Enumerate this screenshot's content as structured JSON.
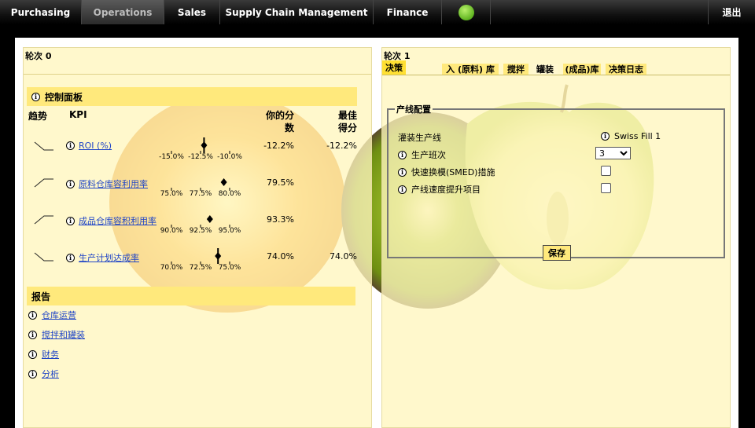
{
  "nav": {
    "tabs": [
      "Purchasing",
      "Operations",
      "Sales",
      "Supply Chain Management",
      "Finance"
    ],
    "active_tab": "Operations",
    "logout": "退出"
  },
  "left": {
    "round_title": "轮次 0",
    "dashboard_title": "控制面板",
    "col_trend": "趋势",
    "col_kpi": "KPI",
    "col_score": "你的分数",
    "col_best": "最佳得分",
    "kpis": [
      {
        "trend": "down",
        "name": "ROI (%)",
        "score": "-12.2%",
        "best": "-12.2%",
        "ticks": [
          "-15.0%",
          "-12.5%",
          "-10.0%"
        ],
        "marker": "-12.2"
      },
      {
        "trend": "up",
        "name": "原料仓库容利用率",
        "score": "79.5%",
        "best": "",
        "ticks": [
          "75.0%",
          "77.5%",
          "80.0%"
        ],
        "marker": "79.5"
      },
      {
        "trend": "up",
        "name": "成品仓库容积利用率",
        "score": "93.3%",
        "best": "",
        "ticks": [
          "90.0%",
          "92.5%",
          "95.0%"
        ],
        "marker": "93.3"
      },
      {
        "trend": "down",
        "name": "生产计划达成率",
        "score": "74.0%",
        "best": "74.0%",
        "ticks": [
          "70.0%",
          "72.5%",
          "75.0%"
        ],
        "marker": "74.0"
      }
    ],
    "report_title": "报告",
    "reports": [
      "仓库运营",
      "搅拌和罐装",
      "财务",
      "分析"
    ]
  },
  "right": {
    "round_title": "轮次 1",
    "tabs": [
      "决策",
      "入 (原料) 库",
      "搅拌",
      "罐装",
      "(成品)库",
      "决策日志"
    ],
    "active_tab": "决策",
    "config": {
      "legend": "产线配置",
      "line_label": "灌装生产线",
      "line_value": "Swiss Fill 1",
      "shift_label": "生产班次",
      "shift_value": "3",
      "smed_label": "快速换模(SMED)措施",
      "speed_label": "产线速度提升项目",
      "save_label": "保存"
    }
  },
  "colors": {
    "accent": "#ffe97c",
    "link": "#2045c6",
    "panel_bg": "#fff6be"
  }
}
